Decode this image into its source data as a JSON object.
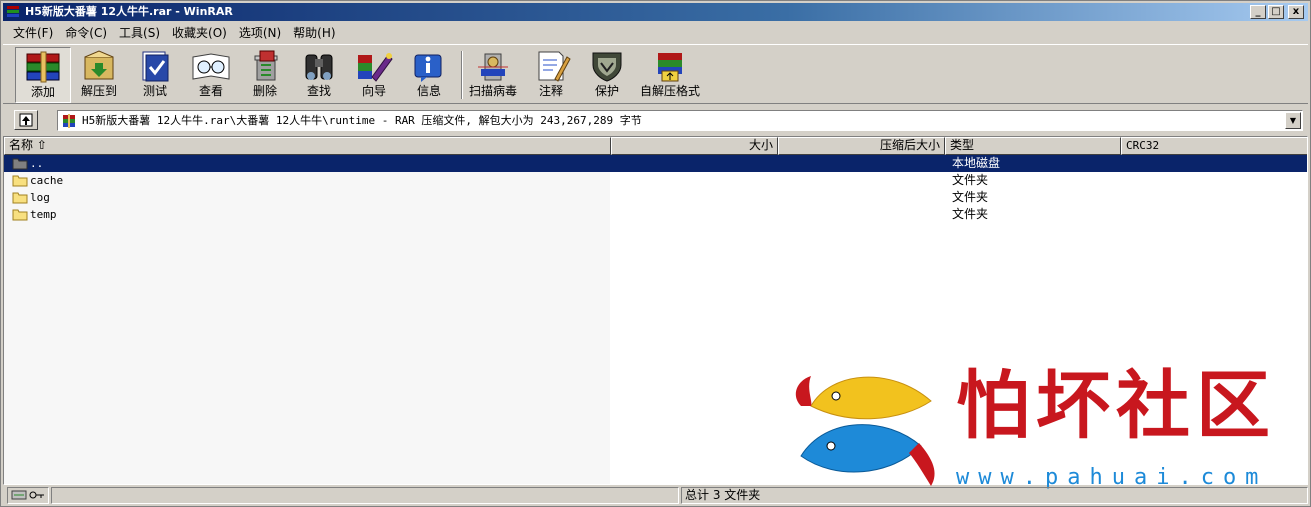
{
  "window": {
    "title": "H5新版大番薯 12人牛牛.rar - WinRAR",
    "buttons": [
      "_",
      "□",
      "x"
    ]
  },
  "menu": [
    "文件(F)",
    "命令(C)",
    "工具(S)",
    "收藏夹(O)",
    "选项(N)",
    "帮助(H)"
  ],
  "toolbar": [
    {
      "label": "添加",
      "icon": "add-icon"
    },
    {
      "label": "解压到",
      "icon": "extract-icon"
    },
    {
      "label": "测试",
      "icon": "test-icon"
    },
    {
      "label": "查看",
      "icon": "view-icon"
    },
    {
      "label": "删除",
      "icon": "delete-icon"
    },
    {
      "label": "查找",
      "icon": "find-icon"
    },
    {
      "label": "向导",
      "icon": "wizard-icon"
    },
    {
      "label": "信息",
      "icon": "info-icon"
    },
    {
      "label": "扫描病毒",
      "icon": "scan-virus-icon"
    },
    {
      "label": "注释",
      "icon": "comment-icon"
    },
    {
      "label": "保护",
      "icon": "protect-icon"
    },
    {
      "label": "自解压格式",
      "icon": "sfx-icon"
    }
  ],
  "address": {
    "path": "H5新版大番薯 12人牛牛.rar\\大番薯 12人牛牛\\runtime - RAR 压缩文件, 解包大小为 243,267,289 字节"
  },
  "columns": {
    "name": "名称 ⇧",
    "size": "大小",
    "packed": "压缩后大小",
    "type": "类型",
    "crc": "CRC32"
  },
  "files": [
    {
      "name": "..",
      "type": "本地磁盘",
      "selected": true
    },
    {
      "name": "cache",
      "type": "文件夹",
      "selected": false
    },
    {
      "name": "log",
      "type": "文件夹",
      "selected": false
    },
    {
      "name": "temp",
      "type": "文件夹",
      "selected": false
    }
  ],
  "status": {
    "summary": "总计 3 文件夹"
  },
  "watermark": {
    "text": "怕坏社区",
    "url": "www.pahuai.com"
  },
  "colors": {
    "selection": "#0a246a",
    "title_start": "#0a246a",
    "watermark_red": "#c8171e",
    "watermark_blue": "#1d8ad8"
  }
}
